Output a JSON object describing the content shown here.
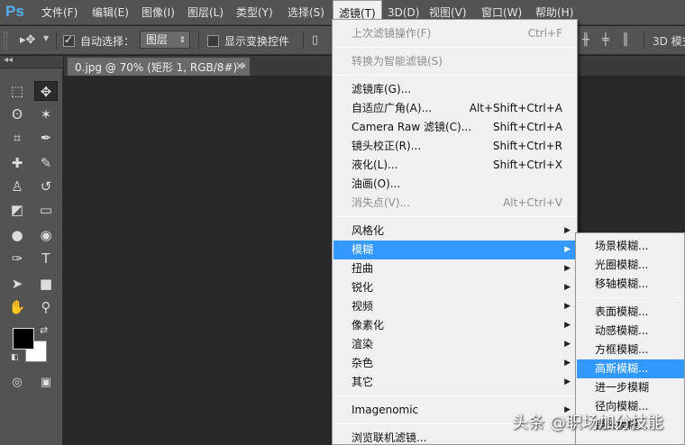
{
  "app": {
    "logo": "Ps"
  },
  "menubar": {
    "items": [
      {
        "label": "文件(F)"
      },
      {
        "label": "编辑(E)"
      },
      {
        "label": "图像(I)"
      },
      {
        "label": "图层(L)"
      },
      {
        "label": "类型(Y)"
      },
      {
        "label": "选择(S)"
      },
      {
        "label": "滤镜(T)"
      },
      {
        "label": "3D(D)"
      },
      {
        "label": "视图(V)"
      },
      {
        "label": "窗口(W)"
      },
      {
        "label": "帮助(H)"
      }
    ],
    "active_index": 6
  },
  "options": {
    "tool_icon": "move-tool-icon",
    "auto_select_label": "自动选择：",
    "auto_select_checked": true,
    "auto_select_value": "图层",
    "show_transform_label": "显示变换控件",
    "show_transform_checked": false,
    "mode_3d_label": "3D 模式"
  },
  "toolbar": {
    "collapse_glyph": "◂◂",
    "tools": [
      {
        "name": "marquee-tool-icon",
        "glyph": "⬚"
      },
      {
        "name": "move-tool-icon",
        "glyph": "✥",
        "selected": true
      },
      {
        "name": "lasso-tool-icon",
        "glyph": "ʘ"
      },
      {
        "name": "magic-wand-tool-icon",
        "glyph": "✶"
      },
      {
        "name": "crop-tool-icon",
        "glyph": "⌗"
      },
      {
        "name": "eyedropper-tool-icon",
        "glyph": "✒"
      },
      {
        "name": "healing-brush-tool-icon",
        "glyph": "✚"
      },
      {
        "name": "brush-tool-icon",
        "glyph": "✎"
      },
      {
        "name": "clone-stamp-tool-icon",
        "glyph": "♙"
      },
      {
        "name": "history-brush-tool-icon",
        "glyph": "↺"
      },
      {
        "name": "eraser-tool-icon",
        "glyph": "◩"
      },
      {
        "name": "gradient-tool-icon",
        "glyph": "▭"
      },
      {
        "name": "blur-tool-icon",
        "glyph": "●"
      },
      {
        "name": "dodge-tool-icon",
        "glyph": "◉"
      },
      {
        "name": "pen-tool-icon",
        "glyph": "✑"
      },
      {
        "name": "type-tool-icon",
        "glyph": "T"
      },
      {
        "name": "path-selection-tool-icon",
        "glyph": "➤"
      },
      {
        "name": "rectangle-tool-icon",
        "glyph": "■"
      },
      {
        "name": "hand-tool-icon",
        "glyph": "✋"
      },
      {
        "name": "zoom-tool-icon",
        "glyph": "⚲"
      }
    ],
    "foreground_color": "#000000",
    "background_color": "#ffffff",
    "quick_mask_glyph": "◎",
    "screen_mode_glyph": "▣"
  },
  "document": {
    "tab_title": "0.jpg @ 70% (矩形 1, RGB/8#) *",
    "close_glyph": "×"
  },
  "filter_menu": {
    "items": [
      {
        "label": "上次滤镜操作(F)",
        "shortcut": "Ctrl+F",
        "disabled": true
      },
      {
        "sep": true
      },
      {
        "label": "转换为智能滤镜(S)",
        "disabled": true
      },
      {
        "sep": true
      },
      {
        "label": "滤镜库(G)..."
      },
      {
        "label": "自适应广角(A)...",
        "shortcut": "Alt+Shift+Ctrl+A"
      },
      {
        "label": "Camera Raw 滤镜(C)...",
        "shortcut": "Shift+Ctrl+A"
      },
      {
        "label": "镜头校正(R)...",
        "shortcut": "Shift+Ctrl+R"
      },
      {
        "label": "液化(L)...",
        "shortcut": "Shift+Ctrl+X"
      },
      {
        "label": "油画(O)..."
      },
      {
        "label": "消失点(V)...",
        "shortcut": "Alt+Ctrl+V",
        "disabled": true
      },
      {
        "sep": true
      },
      {
        "label": "风格化",
        "submenu": true
      },
      {
        "label": "模糊",
        "submenu": true,
        "highlighted": true
      },
      {
        "label": "扭曲",
        "submenu": true
      },
      {
        "label": "锐化",
        "submenu": true
      },
      {
        "label": "视频",
        "submenu": true
      },
      {
        "label": "像素化",
        "submenu": true
      },
      {
        "label": "渲染",
        "submenu": true
      },
      {
        "label": "杂色",
        "submenu": true
      },
      {
        "label": "其它",
        "submenu": true
      },
      {
        "sep": true
      },
      {
        "label": "Imagenomic",
        "submenu": true
      },
      {
        "sep": true
      },
      {
        "label": "浏览联机滤镜..."
      }
    ]
  },
  "blur_submenu": {
    "items": [
      {
        "label": "场景模糊..."
      },
      {
        "label": "光圈模糊..."
      },
      {
        "label": "移轴模糊..."
      },
      {
        "sep": true
      },
      {
        "label": "表面模糊..."
      },
      {
        "label": "动感模糊..."
      },
      {
        "label": "方框模糊..."
      },
      {
        "label": "高斯模糊...",
        "highlighted": true
      },
      {
        "label": "进一步模糊"
      },
      {
        "label": "径向模糊..."
      },
      {
        "label": "镜头模糊..."
      }
    ]
  },
  "watermark": "头条 @职场加分技能",
  "colors": {
    "highlight": "#3399ff",
    "panel": "#535353",
    "canvas": "#282828"
  }
}
